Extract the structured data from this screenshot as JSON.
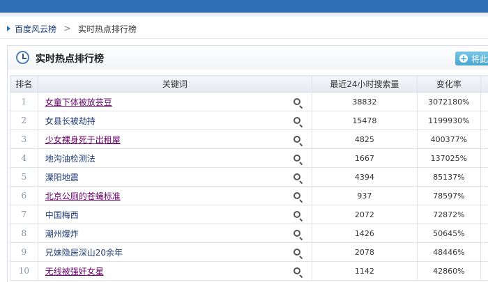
{
  "breadcrumb": {
    "root": "百度风云榜",
    "separator": ">",
    "current": "实时热点排行榜"
  },
  "panel": {
    "title": "实时热点排行榜",
    "button_label": "将此"
  },
  "table": {
    "headers": {
      "rank": "排名",
      "keyword": "关键词",
      "searches": "最近24小时搜索量",
      "change": "变化率"
    },
    "rows": [
      {
        "rank": "1",
        "keyword": "女童下体被放芸豆",
        "searches": "38832",
        "change": "3072180%",
        "visited": true
      },
      {
        "rank": "2",
        "keyword": "女县长被劫持",
        "searches": "15478",
        "change": "1199930%",
        "visited": false
      },
      {
        "rank": "3",
        "keyword": "少女裸身死于出租屋",
        "searches": "4825",
        "change": "400377%",
        "visited": true
      },
      {
        "rank": "4",
        "keyword": "地沟油检测法",
        "searches": "1667",
        "change": "137025%",
        "visited": false
      },
      {
        "rank": "5",
        "keyword": "溧阳地震",
        "searches": "4394",
        "change": "85137%",
        "visited": false
      },
      {
        "rank": "6",
        "keyword": "北京公厕的苍蝇标准",
        "searches": "937",
        "change": "78597%",
        "visited": true
      },
      {
        "rank": "7",
        "keyword": "中国梅西",
        "searches": "2072",
        "change": "72872%",
        "visited": false
      },
      {
        "rank": "8",
        "keyword": "潮州爆炸",
        "searches": "1426",
        "change": "50645%",
        "visited": false
      },
      {
        "rank": "9",
        "keyword": "兄妹隐居深山20余年",
        "searches": "2078",
        "change": "48446%",
        "visited": false
      },
      {
        "rank": "10",
        "keyword": "无线被强奸女星",
        "searches": "1142",
        "change": "42860%",
        "visited": true
      }
    ]
  },
  "icons": {
    "clock": "clock-icon",
    "search": "search-icon",
    "plus": "plus-icon"
  },
  "colors": {
    "topbar": "#2f6fb5",
    "link": "#1f3c74",
    "visited_link": "#660066",
    "button": "#4aa5cf"
  }
}
